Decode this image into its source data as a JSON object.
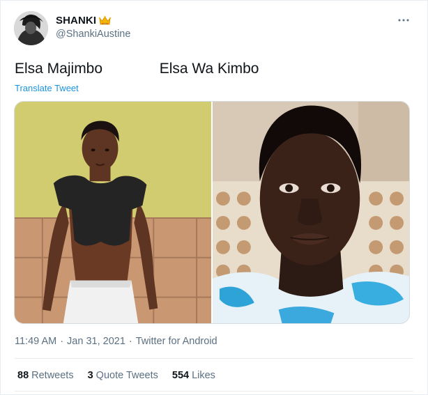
{
  "author": {
    "display_name": "SHANKI",
    "handle": "@ShankiAustine",
    "name_emoji": "crown-emoji"
  },
  "tweet": {
    "text": "Elsa Majimbo              Elsa Wa Kimbo",
    "translate_label": "Translate Tweet"
  },
  "media": {
    "photos": [
      {
        "description_icon": "portrait-photo-left"
      },
      {
        "description_icon": "portrait-photo-right"
      }
    ]
  },
  "meta": {
    "time": "11:49 AM",
    "separator_1": "·",
    "date": "Jan 31, 2021",
    "separator_2": "·",
    "source": "Twitter for Android"
  },
  "stats": {
    "retweets_count": "88",
    "retweets_label": "Retweets",
    "quotes_count": "3",
    "quotes_label": "Quote Tweets",
    "likes_count": "554",
    "likes_label": "Likes"
  },
  "colors": {
    "link": "#1b95e0",
    "secondary_text": "#5b7083",
    "primary_text": "#0f1419",
    "border": "#e6ecf0"
  }
}
